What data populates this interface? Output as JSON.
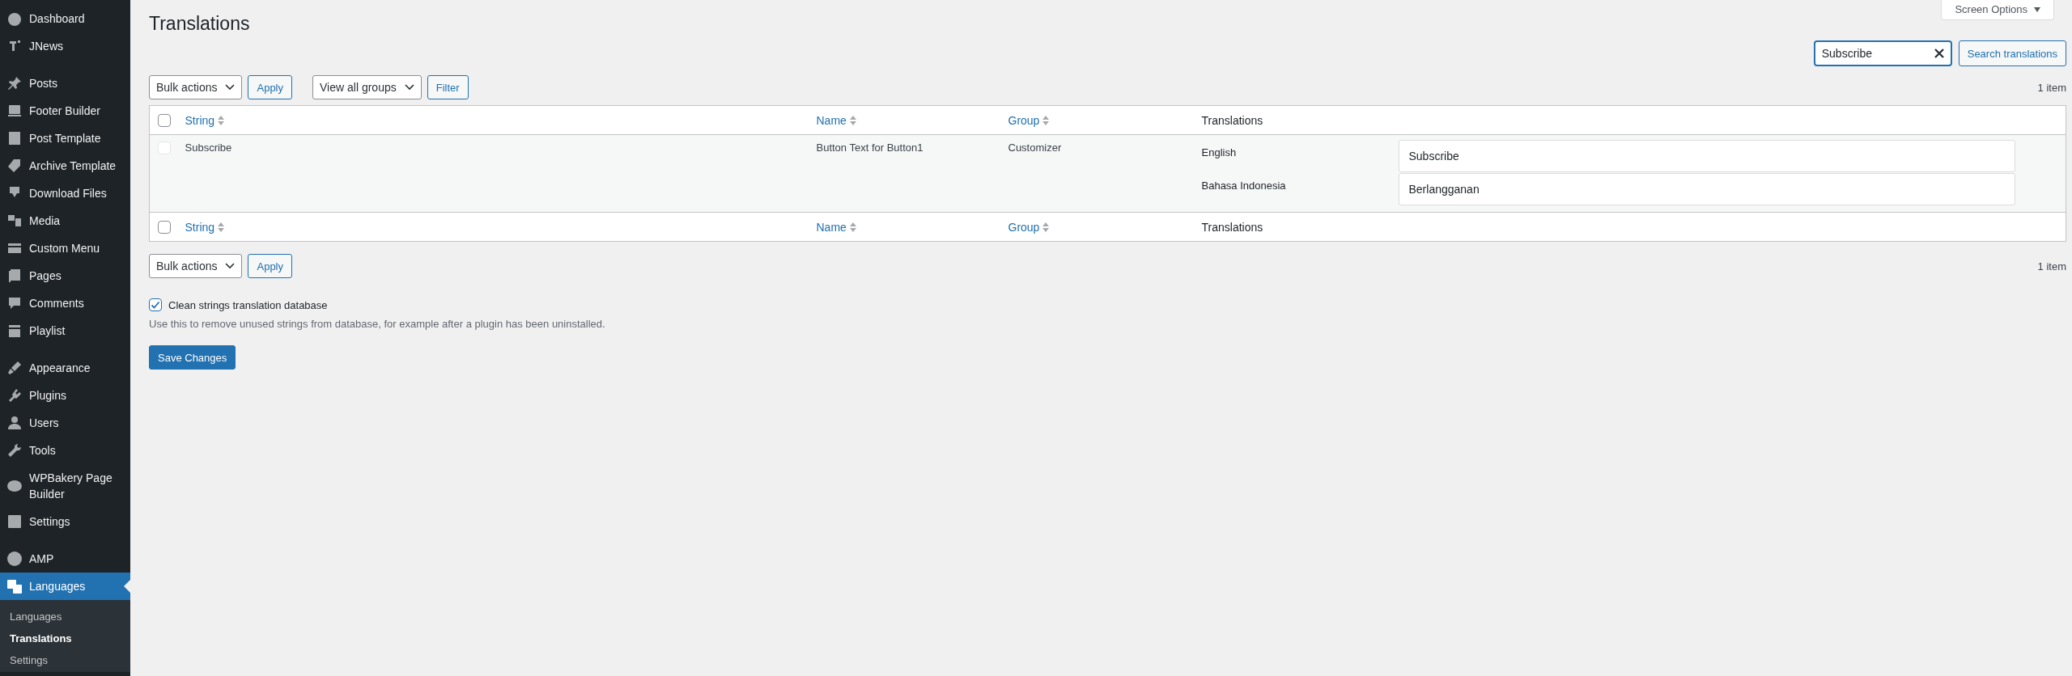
{
  "sidebar": {
    "groups": [
      [
        {
          "label": "Dashboard",
          "selected": false
        },
        {
          "label": "JNews",
          "selected": false
        }
      ],
      [
        {
          "label": "Posts",
          "selected": false
        },
        {
          "label": "Footer Builder",
          "selected": false
        },
        {
          "label": "Post Template",
          "selected": false
        },
        {
          "label": "Archive Template",
          "selected": false
        },
        {
          "label": "Download Files",
          "selected": false
        },
        {
          "label": "Media",
          "selected": false
        },
        {
          "label": "Custom Menu",
          "selected": false
        },
        {
          "label": "Pages",
          "selected": false
        },
        {
          "label": "Comments",
          "selected": false
        },
        {
          "label": "Playlist",
          "selected": false
        }
      ],
      [
        {
          "label": "Appearance",
          "selected": false
        },
        {
          "label": "Plugins",
          "selected": false
        },
        {
          "label": "Users",
          "selected": false
        },
        {
          "label": "Tools",
          "selected": false
        },
        {
          "label": "WPBakery Page Builder",
          "selected": false
        },
        {
          "label": "Settings",
          "selected": false
        }
      ],
      [
        {
          "label": "AMP",
          "selected": false
        },
        {
          "label": "Languages",
          "selected": true
        }
      ]
    ],
    "submenu": [
      {
        "label": "Languages",
        "selected": false
      },
      {
        "label": "Translations",
        "selected": true
      },
      {
        "label": "Settings",
        "selected": false
      }
    ]
  },
  "screen_options": "Screen Options",
  "title": "Translations",
  "search": {
    "value": "Subscribe",
    "button": "Search translations"
  },
  "top_toolbar": {
    "bulk_select": "Bulk actions",
    "apply": "Apply",
    "group_select": "View all groups",
    "filter": "Filter",
    "count": "1 item"
  },
  "table": {
    "header_checked": false,
    "header_columns": [
      {
        "label": "String",
        "sortable": true
      },
      {
        "label": "Name",
        "sortable": true
      },
      {
        "label": "Group",
        "sortable": true
      },
      {
        "label": "Translations",
        "sortable": false
      }
    ],
    "rows": [
      {
        "checked": false,
        "string": "Subscribe",
        "name": "Button Text for Button1",
        "group": "Customizer",
        "translations": [
          {
            "language": "English",
            "value": "Subscribe"
          },
          {
            "language": "Bahasa Indonesia",
            "value": "Berlangganan"
          }
        ]
      }
    ],
    "footer_checked": false,
    "footer_columns": [
      {
        "label": "String",
        "sortable": true
      },
      {
        "label": "Name",
        "sortable": true
      },
      {
        "label": "Group",
        "sortable": true
      },
      {
        "label": "Translations",
        "sortable": false
      }
    ]
  },
  "bottom_toolbar": {
    "bulk_select": "Bulk actions",
    "apply": "Apply",
    "count": "1 item"
  },
  "clean_option": {
    "label": "Clean strings translation database",
    "checked": true,
    "description": "Use this to remove unused strings from database, for example after a plugin has been uninstalled."
  },
  "save_button": "Save Changes"
}
